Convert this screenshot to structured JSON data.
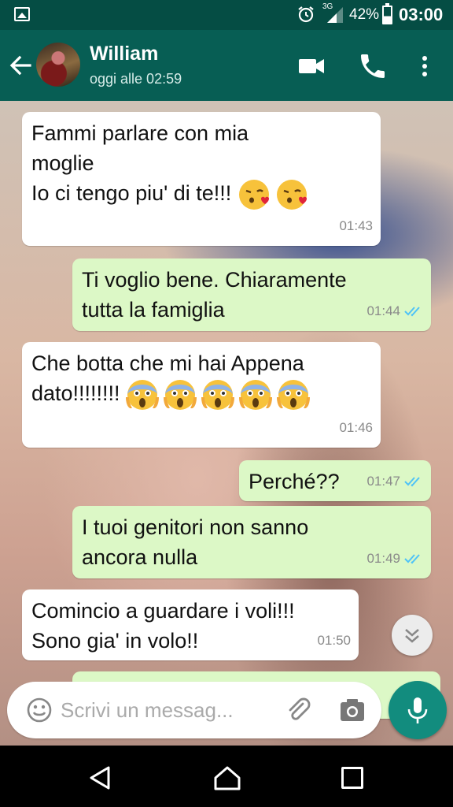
{
  "status_bar": {
    "network": "3G",
    "battery_percent": "42%",
    "battery_level": 0.42,
    "time": "03:00",
    "icons": [
      "image-notification-icon",
      "alarm-icon",
      "signal-icon",
      "battery-icon"
    ]
  },
  "header": {
    "contact_name": "William",
    "last_seen": "oggi alle 02:59",
    "icons": [
      "back-arrow-icon",
      "video-call-icon",
      "phone-icon",
      "more-vert-icon"
    ]
  },
  "colors": {
    "header": "#075e54",
    "status_bar": "#054d44",
    "outgoing_bubble": "#dcf8c6",
    "incoming_bubble": "#ffffff",
    "read_ticks": "#4fc3f7",
    "mic_button": "#128c7e"
  },
  "messages": [
    {
      "direction": "in",
      "text": "Fammi parlare con mia\nmoglie\nIo ci tengo piu' di te!!!",
      "emoji": [
        "kissing-heart",
        "kissing-heart"
      ],
      "time": "01:43"
    },
    {
      "direction": "out",
      "text": "Ti voglio bene. Chiaramente\ntutta la famiglia",
      "time": "01:44",
      "status": "read"
    },
    {
      "direction": "in",
      "text": "Che botta che mi hai Appena\ndato!!!!!!!!",
      "emoji": [
        "scream",
        "scream",
        "scream",
        "scream",
        "scream"
      ],
      "time": "01:46"
    },
    {
      "direction": "out",
      "text": "Perché??",
      "time": "01:47",
      "status": "read"
    },
    {
      "direction": "out",
      "text": "I tuoi genitori non sanno\nancora nulla",
      "time": "01:49",
      "status": "read"
    },
    {
      "direction": "in",
      "text": "Comincio a guardare i voli!!!\nSono gia' in volo!!",
      "time": "01:50"
    }
  ],
  "input": {
    "placeholder": "Scrivi un messag..."
  },
  "nav": {
    "icons": [
      "nav-back-icon",
      "nav-home-icon",
      "nav-recents-icon"
    ]
  }
}
